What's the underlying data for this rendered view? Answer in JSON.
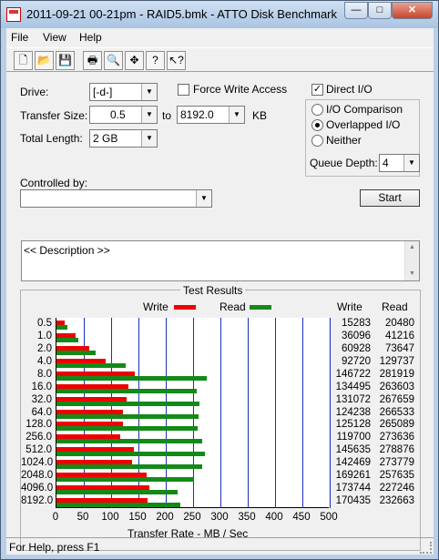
{
  "window": {
    "title": "2011-09-21 00-21pm - RAID5.bmk - ATTO Disk Benchmark",
    "min_icon": "minimize-icon",
    "max_icon": "maximize-icon",
    "close_icon": "close-icon"
  },
  "menu": [
    "File",
    "View",
    "Help"
  ],
  "toolbar": [
    "new-icon",
    "open-icon",
    "save-icon",
    "print-icon",
    "print-preview-icon",
    "move-icon",
    "help-icon",
    "context-help-icon"
  ],
  "form": {
    "drive_label": "Drive:",
    "drive_value": "[-d-]",
    "force_write_access_label": "Force Write Access",
    "direct_io_label": "Direct I/O",
    "transfer_size_label": "Transfer Size:",
    "transfer_from": "0.5",
    "to_label": "to",
    "transfer_to": "8192.0",
    "kb_label": "KB",
    "io_comparison_label": "I/O Comparison",
    "overlapped_io_label": "Overlapped I/O",
    "neither_label": "Neither",
    "total_length_label": "Total Length:",
    "total_length_value": "2 GB",
    "queue_depth_label": "Queue Depth:",
    "queue_depth_value": "4",
    "controlled_by_label": "Controlled by:",
    "controlled_by_value": "",
    "start_label": "Start",
    "description": "<< Description >>"
  },
  "results": {
    "title": "Test Results",
    "legend_write": "Write",
    "legend_read": "Read",
    "col_write": "Write",
    "col_read": "Read",
    "x_title": "Transfer Rate - MB / Sec",
    "colors": {
      "write": "#e00000",
      "read": "#138a18",
      "grid": "#1a2fbb"
    }
  },
  "chart_data": {
    "type": "bar",
    "title": "Test Results",
    "xlabel": "Transfer Rate - MB / Sec",
    "xlim": [
      0,
      500
    ],
    "x_ticks": [
      0,
      50,
      100,
      150,
      200,
      250,
      300,
      350,
      400,
      450,
      500
    ],
    "categories": [
      "0.5",
      "1.0",
      "2.0",
      "4.0",
      "8.0",
      "16.0",
      "32.0",
      "64.0",
      "128.0",
      "256.0",
      "512.0",
      "1024.0",
      "2048.0",
      "4096.0",
      "8192.0"
    ],
    "series": [
      {
        "name": "Write",
        "values_kb": [
          15283,
          36096,
          60928,
          92720,
          146722,
          134495,
          131072,
          124238,
          125128,
          119700,
          145635,
          142469,
          169261,
          173744,
          170435
        ]
      },
      {
        "name": "Read",
        "values_kb": [
          20480,
          41216,
          73647,
          129737,
          281919,
          263603,
          267659,
          266533,
          265089,
          273636,
          278876,
          273779,
          257635,
          227246,
          232663
        ]
      }
    ],
    "legend": "top"
  },
  "status": {
    "text": "For Help, press F1"
  }
}
